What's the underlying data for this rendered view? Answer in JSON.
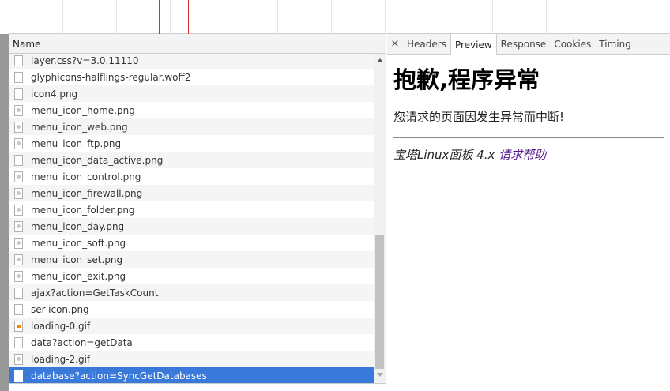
{
  "network": {
    "column_name": "Name",
    "files": [
      {
        "name": "layer.css?v=3.0.11110",
        "icon": "document-icon"
      },
      {
        "name": "glyphicons-halflings-regular.woff2",
        "icon": "document-icon"
      },
      {
        "name": "icon4.png",
        "icon": "document-icon"
      },
      {
        "name": "menu_icon_home.png",
        "icon": "image-icon"
      },
      {
        "name": "menu_icon_web.png",
        "icon": "image-icon"
      },
      {
        "name": "menu_icon_ftp.png",
        "icon": "image-icon"
      },
      {
        "name": "menu_icon_data_active.png",
        "icon": "document-icon"
      },
      {
        "name": "menu_icon_control.png",
        "icon": "image-icon"
      },
      {
        "name": "menu_icon_firewall.png",
        "icon": "image-icon"
      },
      {
        "name": "menu_icon_folder.png",
        "icon": "image-icon"
      },
      {
        "name": "menu_icon_day.png",
        "icon": "image-icon"
      },
      {
        "name": "menu_icon_soft.png",
        "icon": "image-icon"
      },
      {
        "name": "menu_icon_set.png",
        "icon": "image-icon"
      },
      {
        "name": "menu_icon_exit.png",
        "icon": "image-icon"
      },
      {
        "name": "ajax?action=GetTaskCount",
        "icon": "document-icon"
      },
      {
        "name": "ser-icon.png",
        "icon": "document-icon"
      },
      {
        "name": "loading-0.gif",
        "icon": "gif-icon"
      },
      {
        "name": "data?action=getData",
        "icon": "document-icon"
      },
      {
        "name": "loading-2.gif",
        "icon": "image-icon"
      },
      {
        "name": "database?action=SyncGetDatabases",
        "icon": "document-icon",
        "selected": true
      }
    ]
  },
  "detail": {
    "close_glyph": "×",
    "tabs": [
      "Headers",
      "Preview",
      "Response",
      "Cookies",
      "Timing"
    ],
    "active_tab": "Preview",
    "preview": {
      "title": "抱歉,程序异常",
      "message": "您请求的页面因发生异常而中断!",
      "footer_text": "宝塔Linux面板 4.x ",
      "footer_link": "请求帮助"
    }
  },
  "colors": {
    "selected_row": "#3879d9",
    "timeline_blue": "#3b5bdb",
    "timeline_red": "#e03131"
  }
}
